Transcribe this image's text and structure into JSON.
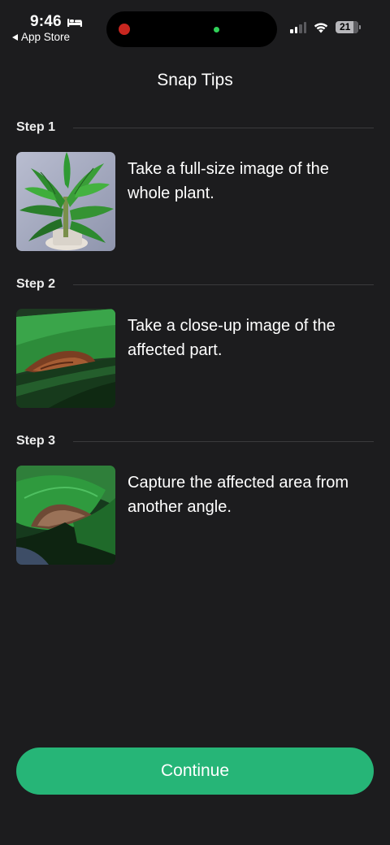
{
  "status_bar": {
    "time": "9:46",
    "back_app": "App Store",
    "battery_level": "21",
    "icons": [
      "bed-icon",
      "signal-icon",
      "wifi-icon",
      "battery-icon"
    ]
  },
  "header": {
    "title": "Snap Tips"
  },
  "steps": [
    {
      "label": "Step 1",
      "text": "Take a full-size image of the whole plant.",
      "image": "whole-plant-photo"
    },
    {
      "label": "Step 2",
      "text": "Take a close-up image of the affected part.",
      "image": "leaf-closeup-photo"
    },
    {
      "label": "Step 3",
      "text": "Capture the affected area from another angle.",
      "image": "leaf-angle-photo"
    }
  ],
  "continue_button": {
    "label": "Continue"
  },
  "colors": {
    "background": "#1c1c1e",
    "accent": "#26b577",
    "divider": "#3a3a3c"
  }
}
